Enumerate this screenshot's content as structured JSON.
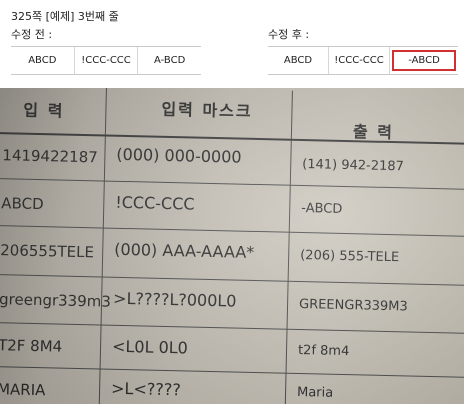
{
  "note": {
    "title": "325쪽 [예제] 3번째 줄",
    "before_label": "수정 전 :",
    "after_label": "수정 후 :",
    "before_cells": [
      "ABCD",
      "!CCC-CCC",
      "A-BCD"
    ],
    "after_cells": [
      "ABCD",
      "!CCC-CCC",
      "-ABCD"
    ],
    "highlight_color": "#d23030"
  },
  "book_table": {
    "headers": [
      "입 력",
      "입력 마스크",
      "출 력"
    ],
    "rows": [
      [
        "1419422187",
        "(000) 000-0000",
        "(141) 942-2187"
      ],
      [
        "ABCD",
        "!CCC-CCC",
        "-ABCD"
      ],
      [
        "206555TELE",
        "(000) AAA-AAAA*",
        "(206) 555-TELE"
      ],
      [
        "greengr339m3",
        ">L????L?000L0",
        "GREENGR339M3"
      ],
      [
        "T2F 8M4",
        "<L0L 0L0",
        "t2f 8m4"
      ],
      [
        "MARIA",
        ">L<????",
        "Maria"
      ]
    ]
  }
}
